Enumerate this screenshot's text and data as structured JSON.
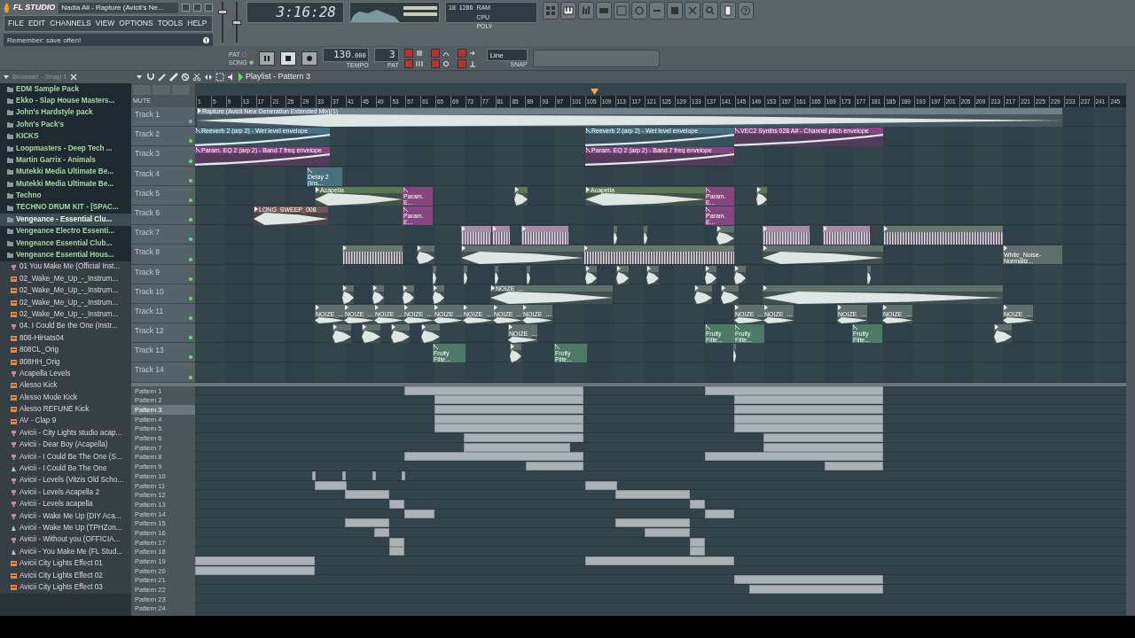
{
  "window": {
    "logo": "FL STUDIO",
    "title": "Nadia Ali - Rapture (Avicii's Ne..."
  },
  "menu": [
    {
      "label": "FILE"
    },
    {
      "label": "EDIT"
    },
    {
      "label": "CHANNELS"
    },
    {
      "label": "VIEW"
    },
    {
      "label": "OPTIONS"
    },
    {
      "label": "TOOLS"
    },
    {
      "label": "HELP"
    }
  ],
  "hint_bar": {
    "text": "Remember: save often!"
  },
  "master_volume": {
    "level": 0.78
  },
  "master_pitch": {
    "level": 0.5
  },
  "clock": {
    "time": "3:16:28"
  },
  "cpu_panel": {
    "values": [
      "18",
      "1286"
    ],
    "labels": [
      "RAM",
      "CPU",
      "POLY"
    ]
  },
  "options": [
    {
      "on": true
    },
    {
      "on": true
    },
    {
      "on": true
    },
    {
      "on": true
    },
    {
      "on": true
    },
    {
      "on": true
    }
  ],
  "transport": {
    "modes": [
      {
        "label": "PAT",
        "selected": false
      },
      {
        "label": "SONG",
        "selected": true
      }
    ],
    "playing": false,
    "tempo": "130",
    "tempo_fraction": ".000",
    "tempo_label": "TEMPO",
    "pattern": "3",
    "pattern_label": "PAT",
    "snap": "Line",
    "snap_label": "SNAP"
  },
  "browser": {
    "title": "Browser - Snap 1",
    "items": [
      {
        "kind": "folder",
        "label": "EDM Sample Pack",
        "selected": false
      },
      {
        "kind": "folder",
        "label": "Ekko - Slap House Masters...",
        "selected": false
      },
      {
        "kind": "folder",
        "label": "John's Hardstyle pack",
        "selected": false
      },
      {
        "kind": "folder",
        "label": "John's Pack's",
        "selected": false
      },
      {
        "kind": "folder",
        "label": "KICKS",
        "selected": false
      },
      {
        "kind": "folder",
        "label": "Loopmasters - Deep Tech ...",
        "selected": false
      },
      {
        "kind": "folder",
        "label": "Martin Garrix - Animals",
        "selected": false
      },
      {
        "kind": "folder",
        "label": "Mutekki Media Ultimate Be...",
        "selected": false
      },
      {
        "kind": "folder",
        "label": "Mutekki Media Ultimate Be...",
        "selected": false
      },
      {
        "kind": "folder",
        "label": "Techno",
        "selected": false
      },
      {
        "kind": "folder",
        "label": "TECHNO DRUM KIT - [SPAC...",
        "selected": false
      },
      {
        "kind": "folder",
        "label": "Vengeance - Essential Clu...",
        "selected": true
      },
      {
        "kind": "folder",
        "label": "Vengeance Electro Essenti...",
        "selected": false
      },
      {
        "kind": "folder",
        "label": "Vengeance Essential Club...",
        "selected": false
      },
      {
        "kind": "folder",
        "label": "Vengeance Essential Hous...",
        "selected": false
      },
      {
        "kind": "preset",
        "label": "01 You Make Me (Official Inst...",
        "selected": false
      },
      {
        "kind": "sample",
        "label": "02_Wake_Me_Up_-_Instrum...",
        "selected": false
      },
      {
        "kind": "sample",
        "label": "02_Wake_Me_Up_-_Instrum...",
        "selected": false
      },
      {
        "kind": "sample",
        "label": "02_Wake_Me_Up_-_Instrum...",
        "selected": false
      },
      {
        "kind": "sample",
        "label": "02_Wake_Me_Up_-_Instrum...",
        "selected": false
      },
      {
        "kind": "preset",
        "label": "04. I Could Be the One (Instr...",
        "selected": false
      },
      {
        "kind": "sample",
        "label": "808-HiHats04",
        "selected": false
      },
      {
        "kind": "sample",
        "label": "808CL_Orig",
        "selected": false
      },
      {
        "kind": "sample",
        "label": "808HH_Orig",
        "selected": false
      },
      {
        "kind": "preset",
        "label": "Acapella Levels",
        "selected": false
      },
      {
        "kind": "sample",
        "label": "Alesso Kick",
        "selected": false
      },
      {
        "kind": "sample",
        "label": "Alesso Mode Kick",
        "selected": false
      },
      {
        "kind": "sample",
        "label": "Alesso REFUNE Kick",
        "selected": false
      },
      {
        "kind": "sample",
        "label": "AV - Clap 9",
        "selected": false
      },
      {
        "kind": "preset",
        "label": "Avicii - City Lights studio acap...",
        "selected": false
      },
      {
        "kind": "preset",
        "label": "Avicii - Dear Boy (Acapella)",
        "selected": false
      },
      {
        "kind": "preset",
        "label": "Avicii - I Could Be The One (S...",
        "selected": false
      },
      {
        "kind": "project",
        "label": "Avicii - I Could Be The One",
        "selected": false
      },
      {
        "kind": "preset",
        "label": "Avicii - Levels (Vitzis Old Scho...",
        "selected": false
      },
      {
        "kind": "preset",
        "label": "Avicii - Levels Acapella 2",
        "selected": false
      },
      {
        "kind": "preset",
        "label": "Avicii - Levels acapella",
        "selected": false
      },
      {
        "kind": "preset",
        "label": "Avicii - Wake Me Up (DIY Aca...",
        "selected": false
      },
      {
        "kind": "project",
        "label": "Avicii - Wake Me Up (TPHZon...",
        "selected": false
      },
      {
        "kind": "preset",
        "label": "Avicii - Without you (OFFICIA...",
        "selected": false
      },
      {
        "kind": "project",
        "label": "Avicii - You Make Me (FL Stud...",
        "selected": false
      },
      {
        "kind": "sample",
        "label": "Avicii City Lights Effect 01",
        "selected": false
      },
      {
        "kind": "sample",
        "label": "Avicii City Lights Effect 02",
        "selected": false
      },
      {
        "kind": "sample",
        "label": "Avicii City Lights Effect 03",
        "selected": false
      }
    ]
  },
  "playlist": {
    "title": "Playlist - Pattern 3",
    "mute_label": "MUTE",
    "ruler": [
      "1",
      "5",
      "9",
      "13",
      "17",
      "21",
      "25",
      "29",
      "33",
      "37",
      "41",
      "45",
      "49",
      "53",
      "57",
      "61",
      "65",
      "69",
      "73",
      "77",
      "81",
      "85",
      "89",
      "93",
      "97",
      "101",
      "105",
      "109",
      "113",
      "117",
      "121",
      "125",
      "129",
      "133",
      "137",
      "141",
      "145",
      "149",
      "153",
      "157",
      "161",
      "165",
      "169",
      "173",
      "177",
      "181",
      "185",
      "189",
      "193",
      "197",
      "201",
      "205",
      "209",
      "213",
      "217",
      "221",
      "225",
      "229",
      "233",
      "237",
      "241",
      "245"
    ],
    "tracks": [
      {
        "name": "Track 1",
        "active": false,
        "clips": [
          {
            "kind": "audio",
            "color": "#6f8088",
            "label": "Rapture (Avicii New Generation Extended Mix)(1)"
          }
        ]
      },
      {
        "name": "Track 2",
        "active": true,
        "clips": [
          {
            "kind": "automation",
            "color": "#47707f",
            "label": "Reeverb 2 (arp 2) - Wet level envelope"
          },
          {
            "kind": "automation",
            "color": "#47707f",
            "label": "Reeverb 2 (arp 2) - Wet level envelope"
          },
          {
            "kind": "automation",
            "color": "#86467f",
            "label": "VEC2 Synths 028 A# - Channel pitch envelope"
          }
        ]
      },
      {
        "name": "Track 3",
        "active": true,
        "clips": [
          {
            "kind": "automation",
            "color": "#86467f",
            "label": "Param. EQ 2 (arp 2) - Band 7 freq envelope"
          },
          {
            "kind": "automation",
            "color": "#86467f",
            "label": "Param. EQ 2 (arp 2) - Band 7 freq envelope"
          }
        ]
      },
      {
        "name": "Track 4",
        "active": true,
        "clips": [
          {
            "kind": "automation",
            "color": "#47707f",
            "label": "Delay 2 (Ins..."
          }
        ]
      },
      {
        "name": "Track 5",
        "active": true,
        "clips": [
          {
            "kind": "audio",
            "color": "#5d7655",
            "label": "Acapella"
          },
          {
            "kind": "automation",
            "color": "#86467f",
            "label": "Param. E..."
          },
          {
            "kind": "audio",
            "color": "#5d7655"
          },
          {
            "kind": "audio",
            "color": "#5d7655",
            "label": "Acapella"
          },
          {
            "kind": "automation",
            "color": "#86467f",
            "label": "Param. E..."
          },
          {
            "kind": "audio",
            "color": "#5d7655"
          }
        ]
      },
      {
        "name": "Track 6",
        "active": true,
        "clips": [
          {
            "kind": "audio",
            "color": "#76545a",
            "label": "LONG_SWEEP_008"
          },
          {
            "kind": "automation",
            "color": "#86467f",
            "label": "Param. E..."
          },
          {
            "kind": "automation",
            "color": "#86467f",
            "label": "Param. E..."
          }
        ]
      },
      {
        "name": "Track 7",
        "active": true,
        "clips": [
          {
            "kind": "pattern",
            "color": "#a78aa6"
          },
          {
            "kind": "pattern",
            "color": "#a78aa6"
          },
          {
            "kind": "pattern",
            "color": "#a78aa6"
          },
          {
            "kind": "audio",
            "color": "#5f6f6c"
          },
          {
            "kind": "audio",
            "color": "#5f6f6c"
          },
          {
            "kind": "audio",
            "color": "#5f6f6c"
          },
          {
            "kind": "pattern",
            "color": "#a78aa6"
          },
          {
            "kind": "pattern",
            "color": "#a78aa6"
          },
          {
            "kind": "pattern",
            "color": "#67776b"
          }
        ]
      },
      {
        "name": "Track 8",
        "active": true,
        "clips": [
          {
            "kind": "pattern",
            "color": "#67776b"
          },
          {
            "kind": "audio",
            "color": "#5f6f6c"
          },
          {
            "kind": "audio",
            "color": "#5f6f6c"
          },
          {
            "kind": "pattern",
            "color": "#67776b"
          },
          {
            "kind": "audio",
            "color": "#5f6f6c"
          },
          {
            "kind": "audio",
            "color": "#5f6f6c",
            "label": "White_Noise-Normaliz..."
          }
        ]
      },
      {
        "name": "Track 9",
        "active": true,
        "clips": [
          {
            "kind": "audio",
            "color": "#5f6f6c"
          },
          {
            "kind": "audio",
            "color": "#5f6f6c"
          },
          {
            "kind": "audio",
            "color": "#5f6f6c"
          },
          {
            "kind": "audio",
            "color": "#5f6f6c"
          },
          {
            "kind": "audio",
            "color": "#5f6f6c"
          },
          {
            "kind": "audio",
            "color": "#5f6f6c"
          },
          {
            "kind": "audio",
            "color": "#5f6f6c"
          },
          {
            "kind": "audio",
            "color": "#5f6f6c"
          },
          {
            "kind": "audio",
            "color": "#5f6f6c"
          },
          {
            "kind": "audio",
            "color": "#5f6f6c"
          }
        ]
      },
      {
        "name": "Track 10",
        "active": true,
        "clips": [
          {
            "kind": "audio",
            "color": "#5f6f6c"
          },
          {
            "kind": "audio",
            "color": "#5f6f6c"
          },
          {
            "kind": "audio",
            "color": "#5f6f6c"
          },
          {
            "kind": "audio",
            "color": "#5f6f6c"
          },
          {
            "kind": "audio",
            "color": "#5f6f6c",
            "label": "NOIZE_..."
          },
          {
            "kind": "audio",
            "color": "#5f6f6c"
          },
          {
            "kind": "audio",
            "color": "#5f6f6c"
          },
          {
            "kind": "audio",
            "color": "#5f6f6c"
          }
        ]
      },
      {
        "name": "Track 11",
        "active": true,
        "clips": [
          {
            "kind": "audio",
            "color": "#5f6f6c",
            "label": "NOIZE_..."
          },
          {
            "kind": "audio",
            "color": "#5f6f6c",
            "label": "NOIZE_..."
          },
          {
            "kind": "audio",
            "color": "#5f6f6c",
            "label": "NOIZE_..."
          },
          {
            "kind": "audio",
            "color": "#5f6f6c",
            "label": "NOIZE_..."
          },
          {
            "kind": "audio",
            "color": "#5f6f6c",
            "label": "NOIZE_..."
          },
          {
            "kind": "audio",
            "color": "#5f6f6c",
            "label": "NOIZE_..."
          },
          {
            "kind": "audio",
            "color": "#5f6f6c",
            "label": "NOIZE_..."
          },
          {
            "kind": "audio",
            "color": "#5f6f6c",
            "label": "NOIZE_..."
          },
          {
            "kind": "audio",
            "color": "#5f6f6c",
            "label": "NOIZE_..."
          },
          {
            "kind": "audio",
            "color": "#5f6f6c",
            "label": "NOIZE_..."
          },
          {
            "kind": "audio",
            "color": "#5f6f6c",
            "label": "NOIZE_..."
          },
          {
            "kind": "audio",
            "color": "#5f6f6c",
            "label": "NOIZE_..."
          },
          {
            "kind": "audio",
            "color": "#5f6f6c",
            "label": "NOIZE_..."
          }
        ]
      },
      {
        "name": "Track 12",
        "active": true,
        "clips": [
          {
            "kind": "audio",
            "color": "#5f6f6c"
          },
          {
            "kind": "audio",
            "color": "#5f6f6c"
          },
          {
            "kind": "audio",
            "color": "#5f6f6c"
          },
          {
            "kind": "audio",
            "color": "#5f6f6c"
          },
          {
            "kind": "audio",
            "color": "#5f6f6c",
            "label": "NOIZE_..."
          },
          {
            "kind": "automation",
            "color": "#4d7a66",
            "label": "Fruity Filte..."
          },
          {
            "kind": "automation",
            "color": "#4d7a66",
            "label": "Fruity Filte..."
          },
          {
            "kind": "automation",
            "color": "#4d7a66",
            "label": "Fruity Filte..."
          },
          {
            "kind": "audio",
            "color": "#5f6f6c"
          }
        ]
      },
      {
        "name": "Track 13",
        "active": true,
        "clips": [
          {
            "kind": "automation",
            "color": "#4d7a66",
            "label": "Fruity Filte..."
          },
          {
            "kind": "audio",
            "color": "#5f6f6c"
          },
          {
            "kind": "automation",
            "color": "#4d7a66",
            "label": "Fruity Filte..."
          },
          {
            "kind": "audio",
            "color": "#5f6f6c"
          }
        ]
      },
      {
        "name": "Track 14",
        "active": true
      }
    ],
    "patterns": [
      {
        "name": "Pattern 1",
        "selected": false
      },
      {
        "name": "Pattern 2",
        "selected": false
      },
      {
        "name": "Pattern 3",
        "selected": true
      },
      {
        "name": "Pattern 4",
        "selected": false
      },
      {
        "name": "Pattern 5",
        "selected": false
      },
      {
        "name": "Pattern 6",
        "selected": false
      },
      {
        "name": "Pattern 7",
        "selected": false
      },
      {
        "name": "Pattern 8",
        "selected": false
      },
      {
        "name": "Pattern 9",
        "selected": false
      },
      {
        "name": "Pattern 10",
        "selected": false
      },
      {
        "name": "Pattern 11",
        "selected": false
      },
      {
        "name": "Pattern 12",
        "selected": false
      },
      {
        "name": "Pattern 13",
        "selected": false
      },
      {
        "name": "Pattern 14",
        "selected": false
      },
      {
        "name": "Pattern 15",
        "selected": false
      },
      {
        "name": "Pattern 16",
        "selected": false
      },
      {
        "name": "Pattern 17",
        "selected": false
      },
      {
        "name": "Pattern 18",
        "selected": false
      },
      {
        "name": "Pattern 19",
        "selected": false
      },
      {
        "name": "Pattern 20",
        "selected": false
      },
      {
        "name": "Pattern 21",
        "selected": false
      },
      {
        "name": "Pattern 22",
        "selected": false
      },
      {
        "name": "Pattern 23",
        "selected": false
      },
      {
        "name": "Pattern 24",
        "selected": false
      }
    ]
  }
}
